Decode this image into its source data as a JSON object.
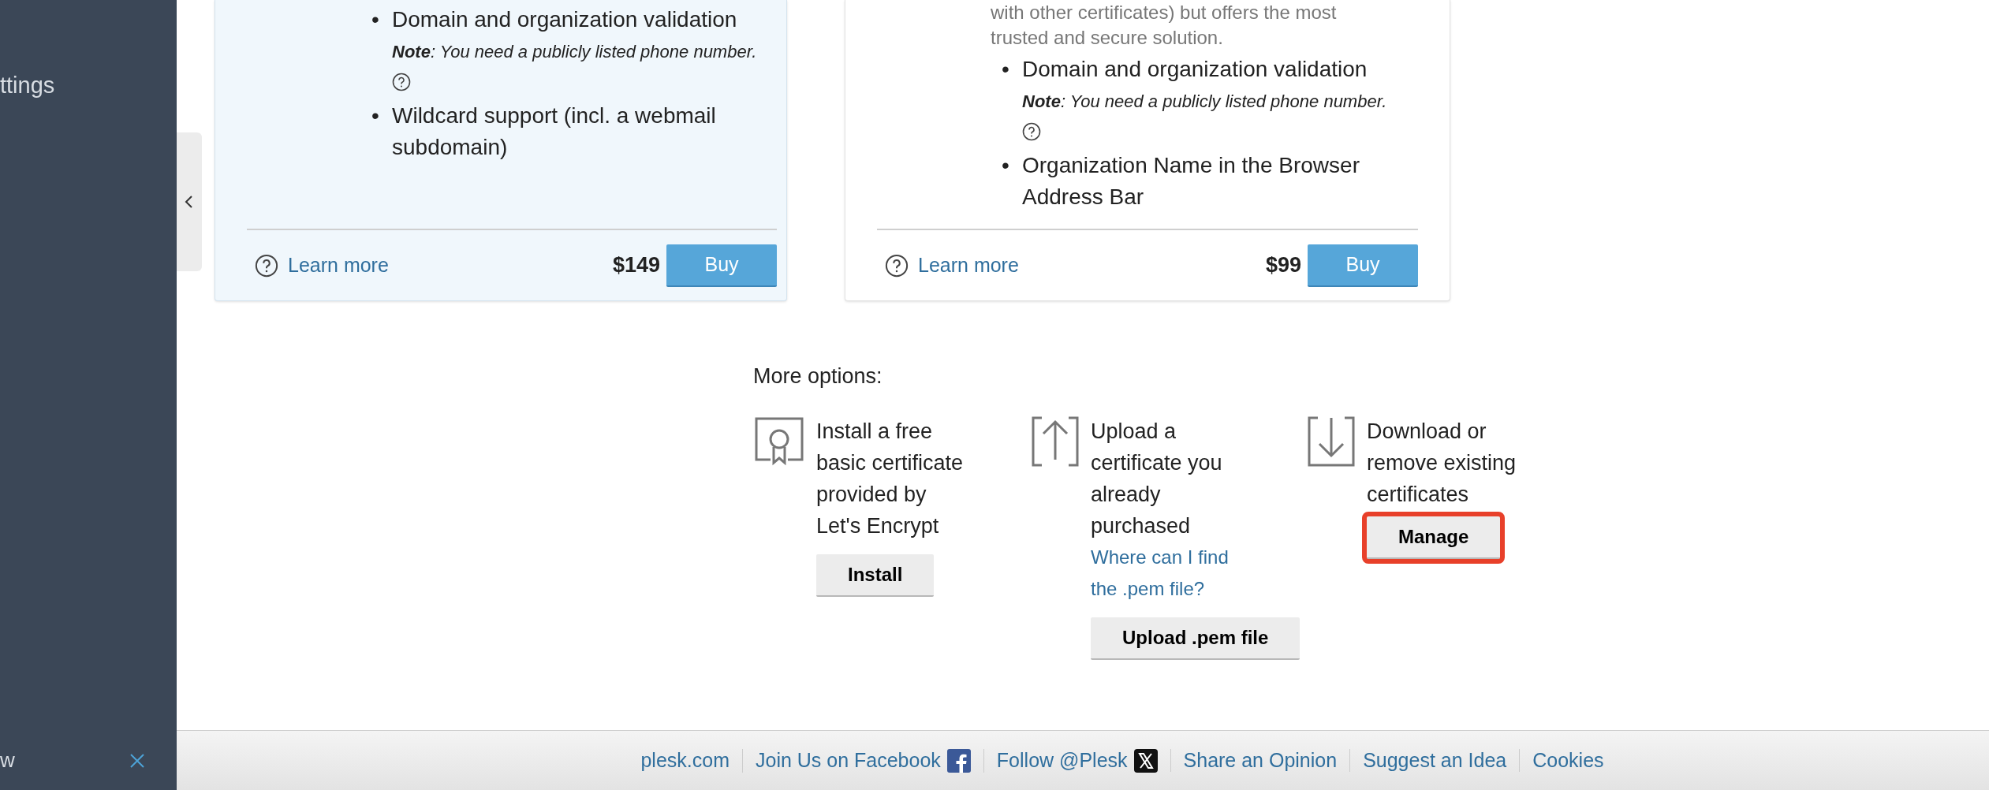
{
  "sidebar": {
    "items": [
      {
        "label": "ttings"
      }
    ],
    "bottom_item": {
      "label": "w"
    }
  },
  "cards": [
    {
      "features": [
        {
          "bullet": "•",
          "text": "Domain and organization validation",
          "note": "**Note**: You need a publicly listed phone number."
        },
        {
          "bullet": "•",
          "text": "Wildcard support (incl. a webmail subdomain)"
        }
      ],
      "learn_more": "Learn more",
      "price": "$149",
      "buy": "Buy",
      "highlighted": true
    },
    {
      "description_lines": [
        "with other certificates) but offers the most",
        "trusted and secure solution."
      ],
      "features": [
        {
          "bullet": "•",
          "text": "Domain and organization validation",
          "note": "**Note**: You need a publicly listed phone number."
        },
        {
          "bullet": "•",
          "text": "Organization Name in the Browser Address Bar"
        }
      ],
      "learn_more": "Learn more",
      "price": "$99",
      "buy": "Buy",
      "highlighted": false
    }
  ],
  "more_options": {
    "title": "More options:",
    "options": [
      {
        "kind": "install",
        "text": "Install a free basic certificate provided by Let's Encrypt",
        "button": "Install",
        "outlined": false
      },
      {
        "kind": "upload",
        "text": "Upload a certificate you already purchased",
        "link": "Where can I find the .pem file?",
        "button": "Upload .pem file",
        "outlined": false
      },
      {
        "kind": "download",
        "text": "Download or remove existing certificates",
        "button": "Manage",
        "outlined": true
      }
    ]
  },
  "footer": {
    "links": [
      {
        "label": "plesk.com"
      },
      {
        "label": "Join Us on Facebook",
        "kind": "facebook"
      },
      {
        "label": "Follow @Plesk",
        "kind": "x"
      },
      {
        "label": "Share an Opinion"
      },
      {
        "label": "Suggest an Idea"
      },
      {
        "label": "Cookies"
      }
    ]
  }
}
